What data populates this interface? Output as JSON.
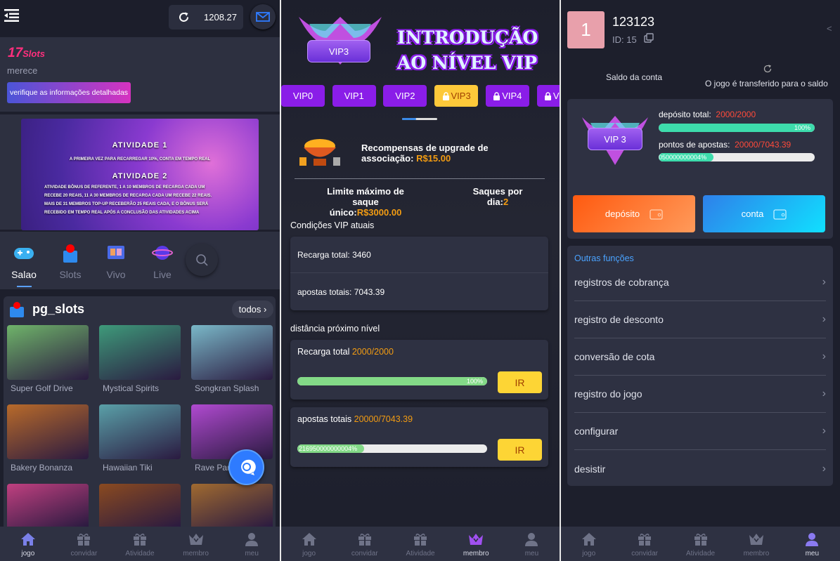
{
  "panel1": {
    "header": {
      "balance": "1208.27",
      "menu_icon": "menu-collapse-icon",
      "refresh_icon": "refresh-icon",
      "mail_icon": "mail-icon"
    },
    "info": {
      "brand_num": "17",
      "brand_word": "Slots",
      "subtitle": "merece",
      "details_button": "verifique as informações detalhadas"
    },
    "banner": {
      "title1": "ATIVIDADE 1",
      "text1": "A PRIMEIRA VEZ PARA RECARREGAR 10%, CONTA EM TEMPO REAL",
      "title2": "ATIVIDADE 2",
      "text2": "ATIVIDADE BÔNUS DE REFERENTE, 1 A 10 MEMBROS DE RECARGA CADA UM RECEBE 20 REAIS, 11 A 30 MEMBROS DE RECARGA CADA UM RECEBE 22 REAIS. MAIS DE 31 MEMBROS TOP-UP RECEBERÃO 25 REAIS CADA, E O BÔNUS SERÁ RECEBIDO EM TEMPO REAL APÓS A CONCLUSÃO DAS ATIVIDADES ACIMA"
    },
    "categories": [
      {
        "label": "Salao",
        "icon": "gamepad-icon",
        "active": true
      },
      {
        "label": "Slots",
        "icon": "slot-joystick-icon"
      },
      {
        "label": "Vivo",
        "icon": "live-screen-icon"
      },
      {
        "label": "Live",
        "icon": "globe-icon"
      }
    ],
    "games_section": {
      "title": "pg_slots",
      "all_button": "todos"
    },
    "games": [
      {
        "name": "Super Golf Drive",
        "color": "#6fb46a"
      },
      {
        "name": "Mystical Spirits",
        "color": "#3e9a7a"
      },
      {
        "name": "Songkran Splash",
        "color": "#7ab8c8"
      },
      {
        "name": "Bakery Bonanza",
        "color": "#b86a2a"
      },
      {
        "name": "Hawaiian Tiki",
        "color": "#5aa0a8"
      },
      {
        "name": "Rave Party",
        "color": "#b04ad0"
      },
      {
        "name": "",
        "color": "#c04080"
      },
      {
        "name": "",
        "color": "#8a4a20"
      },
      {
        "name": "",
        "color": "#a06a30"
      }
    ]
  },
  "panel2": {
    "badge": "VIP3",
    "title_line1": "INTRODUÇÃO",
    "title_line2": "AO NÍVEL VIP",
    "vip_tabs": [
      {
        "label": "VIP0",
        "locked": false
      },
      {
        "label": "VIP1",
        "locked": false
      },
      {
        "label": "VIP2",
        "locked": false
      },
      {
        "label": "VIP3",
        "locked": true,
        "active": true
      },
      {
        "label": "VIP4",
        "locked": true
      },
      {
        "label": "VIP5",
        "locked": true
      }
    ],
    "reward_label": "Recompensas de upgrade de associação:",
    "reward_value": "R$15.00",
    "limit_label": "Limite máximo de saque único:",
    "limit_value": "R$3000.00",
    "per_day_label": "Saques por dia:",
    "per_day_value": "2",
    "current_title": "Condições VIP atuais",
    "current": [
      {
        "label": "Recarga total:",
        "value": "3460"
      },
      {
        "label": "apostas totais:",
        "value": "7043.39"
      }
    ],
    "next_title": "distância próximo nível",
    "next": [
      {
        "label": "Recarga total",
        "value": "2000/2000",
        "percent": 100,
        "bar_text": "100%",
        "button": "IR"
      },
      {
        "label": "apostas totais",
        "value": "20000/7043.39",
        "percent": 35.2,
        "bar_text": "216950000000004%",
        "button": "IR"
      }
    ]
  },
  "panel3": {
    "avatar": "1",
    "username": "123123",
    "id_text": "ID: 15",
    "back": "<",
    "balance_label": "Saldo da conta",
    "transfer_label": "O jogo é transferido para o saldo",
    "badge": "VIP 3",
    "deposit_label": "depósito total:",
    "deposit_value": "2000/2000",
    "deposit_percent": 100,
    "deposit_bar_text": "100%",
    "bets_label": "pontos de apostas:",
    "bets_value": "20000/7043.39",
    "bets_percent": 35.2,
    "bets_bar_text": "050000000004%",
    "deposit_button": "depósito",
    "account_button": "conta",
    "other_title": "Outras funções",
    "menu": [
      "registros de cobrança",
      "registro de desconto",
      "conversão de cota",
      "registro do jogo",
      "configurar",
      "desistir"
    ]
  },
  "nav": [
    {
      "label": "jogo",
      "icon": "home-icon"
    },
    {
      "label": "convidar",
      "icon": "gift-icon"
    },
    {
      "label": "Atividade",
      "icon": "gift-icon"
    },
    {
      "label": "membro",
      "icon": "crown-icon"
    },
    {
      "label": "meu",
      "icon": "user-icon"
    }
  ],
  "colors": {
    "accent_orange": "#f39c12",
    "vip_purple": "#8a1de8",
    "vip_active": "#fdc93a",
    "progress_green": "#83d987",
    "progress_teal": "#3ddcac",
    "link_blue": "#4aa3ff"
  }
}
